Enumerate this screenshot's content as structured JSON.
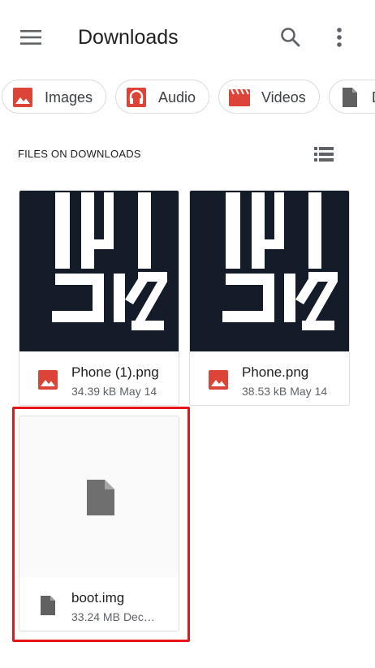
{
  "appbar": {
    "title": "Downloads",
    "menu_icon": "hamburger-menu-icon",
    "search_icon": "search-icon",
    "more_icon": "more-vert-icon"
  },
  "chips": [
    {
      "label": "Images",
      "icon": "image-icon",
      "color": "#db4437"
    },
    {
      "label": "Audio",
      "icon": "headphones-icon",
      "color": "#db4437"
    },
    {
      "label": "Videos",
      "icon": "movie-icon",
      "color": "#db4437"
    },
    {
      "label": "D",
      "icon": "document-icon",
      "color": "#616161"
    }
  ],
  "section": {
    "header": "FILES ON DOWNLOADS",
    "view_icon": "list-view-icon"
  },
  "files": [
    {
      "name": "Phone (1).png",
      "size": "34.39 kB",
      "date": "May 14",
      "type": "image",
      "thumb_text": [
        "TRI",
        "CKZ"
      ]
    },
    {
      "name": "Phone.png",
      "size": "38.53 kB",
      "date": "May 14",
      "type": "image",
      "thumb_text": [
        "TRI",
        "CKZ"
      ]
    },
    {
      "name": "boot.img",
      "size": "33.24 MB",
      "date": "Dec…",
      "type": "file"
    }
  ],
  "colors": {
    "image_icon": "#db4437",
    "file_icon": "#616161",
    "thumb_bg": "#141c29",
    "highlight": "#e8141b"
  }
}
